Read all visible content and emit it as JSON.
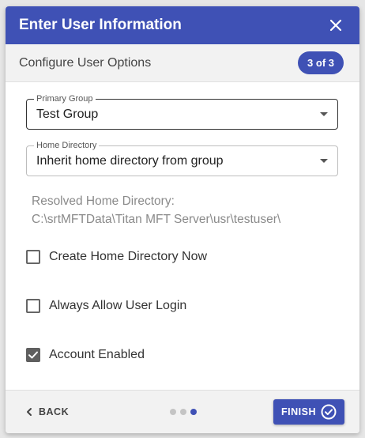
{
  "dialog": {
    "title": "Enter User Information",
    "subtitle": "Configure User Options",
    "step": "3 of 3"
  },
  "form": {
    "primary_group": {
      "label": "Primary Group",
      "value": "Test Group"
    },
    "home_directory": {
      "label": "Home Directory",
      "value": "Inherit home directory from group"
    },
    "resolved_label": "Resolved Home Directory:",
    "resolved_path": "C:\\srtMFTData\\Titan MFT Server\\usr\\testuser\\",
    "checkboxes": [
      {
        "label": "Create Home Directory Now",
        "checked": false
      },
      {
        "label": "Always Allow User Login",
        "checked": false
      },
      {
        "label": "Account Enabled",
        "checked": true
      }
    ]
  },
  "footer": {
    "back_label": "BACK",
    "finish_label": "FINISH",
    "step_count": 3,
    "active_step": 3
  },
  "colors": {
    "primary": "#3f51b5",
    "subheader_bg": "#f2f2f2"
  },
  "icons": {
    "close": "close-icon",
    "back": "chevron-left-icon",
    "finish": "check-circle-icon",
    "dropdown": "caret-down-icon"
  }
}
